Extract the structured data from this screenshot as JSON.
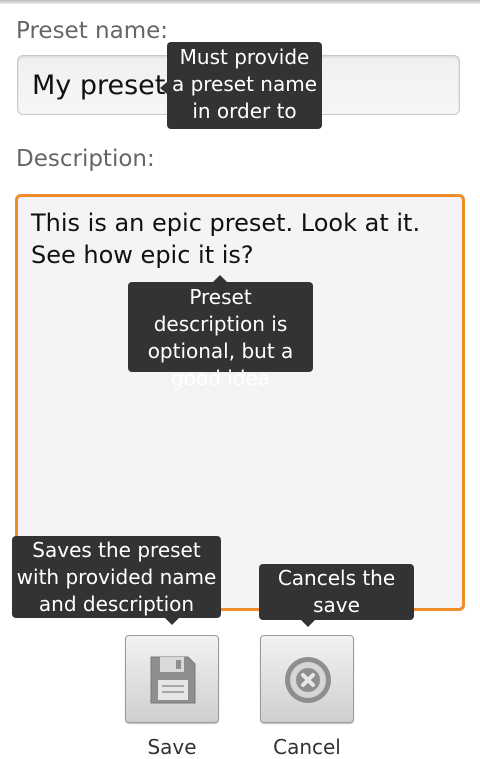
{
  "form": {
    "name_label": "Preset name:",
    "name_value": "My preset",
    "description_label": "Description:",
    "description_value": "This is an epic preset.  Look at it. See how epic it is?"
  },
  "tooltips": {
    "name": "Must provide a preset name in order to save",
    "description": "Preset description is optional, but a good idea",
    "save": "Saves the preset with provided name and description",
    "cancel": "Cancels the save operation"
  },
  "buttons": {
    "save_label": "Save",
    "save_icon": "floppy-disk-icon",
    "cancel_label": "Cancel",
    "cancel_icon": "cancel-circle-icon"
  },
  "colors": {
    "focus_border": "#f08c2a",
    "tooltip_bg": "#333333"
  }
}
